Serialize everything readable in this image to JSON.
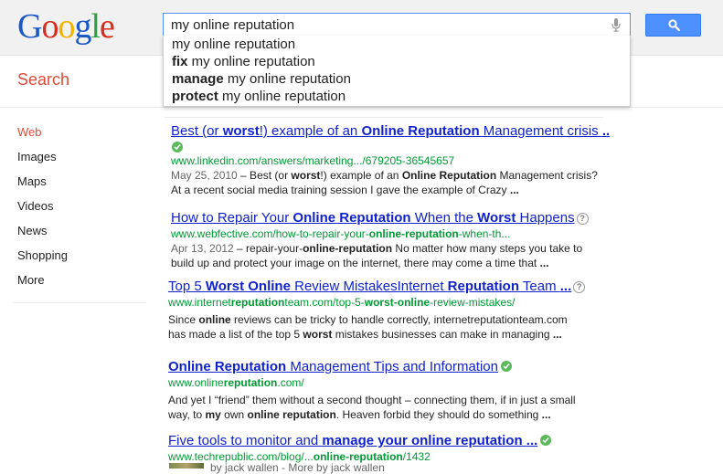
{
  "logo": {
    "letters": [
      "G",
      "o",
      "o",
      "g",
      "l",
      "e"
    ]
  },
  "search": {
    "query": "my online reputation",
    "button_icon": "magnifier-icon",
    "mic_icon": "microphone-icon"
  },
  "suggestions": [
    {
      "bold": "",
      "rest": "my online reputation"
    },
    {
      "bold": "fix",
      "rest": " my online reputation"
    },
    {
      "bold": "manage",
      "rest": " my online reputation"
    },
    {
      "bold": "protect",
      "rest": " my online reputation"
    }
  ],
  "header": {
    "search_label": "Search"
  },
  "nav": {
    "items": [
      "Web",
      "Images",
      "Maps",
      "Videos",
      "News",
      "Shopping",
      "More"
    ],
    "active": "Web"
  },
  "results": [
    {
      "title_parts": [
        "Best (or ",
        "worst",
        "!) example of an ",
        "Online Reputation",
        " Management crisis ",
        ".."
      ],
      "verified": true,
      "url_parts": [
        "www.linkedin.com/answers/marketing.../679205-36545657"
      ],
      "date": "May 25, 2010",
      "snippet_parts": [
        " – Best (or ",
        "worst",
        "!) example of an ",
        "Online Reputation",
        " Management crisis? At a recent social media training session I gave the example of Crazy ",
        "..."
      ]
    },
    {
      "title_parts": [
        "How to Repair Your ",
        "Online Reputation",
        " When the ",
        "Worst",
        " Happens"
      ],
      "help": "?",
      "url_parts": [
        "www.webfective.com/how-to-repair-your-",
        "online-reputation",
        "-when-th..."
      ],
      "date": "Apr 13, 2012",
      "snippet_parts": [
        " – repair-your-",
        "online-reputation",
        " No matter how many steps you take to build up and protect your image on the internet, there may come a time that ",
        "..."
      ]
    },
    {
      "title_parts": [
        "Top 5 ",
        "Worst Online",
        " Review MistakesInternet ",
        "Reputation",
        " Team ",
        "..."
      ],
      "help": "?",
      "url_parts": [
        "www.internet",
        "reputation",
        "team.com/top-5-",
        "worst-online",
        "-review-mistakes/"
      ],
      "snippet_parts": [
        "Since ",
        "online",
        " reviews can be tricky to handle correctly, internetreputationteam.com has made a list of the top 5 ",
        "worst",
        " mistakes businesses can make in managing ",
        "..."
      ]
    },
    {
      "title_parts": [
        "Online Reputation",
        " Management Tips and Information"
      ],
      "verified": true,
      "url_parts": [
        "www.online",
        "reputation",
        ".com/"
      ],
      "snippet_parts": [
        "And yet I “friend” them without a second thought – connecting them, if in just a small way, to ",
        "my",
        " own ",
        "online reputation",
        ". Heaven forbid they should do something ",
        "..."
      ]
    },
    {
      "title_parts": [
        "Five tools to monitor and ",
        "manage your online reputation",
        " ",
        "..."
      ],
      "verified": true,
      "url_parts": [
        "www.techrepublic.com/blog/...",
        "online-reputation",
        "/1432"
      ],
      "byline": "by jack wallen - More by jack wallen"
    }
  ]
}
